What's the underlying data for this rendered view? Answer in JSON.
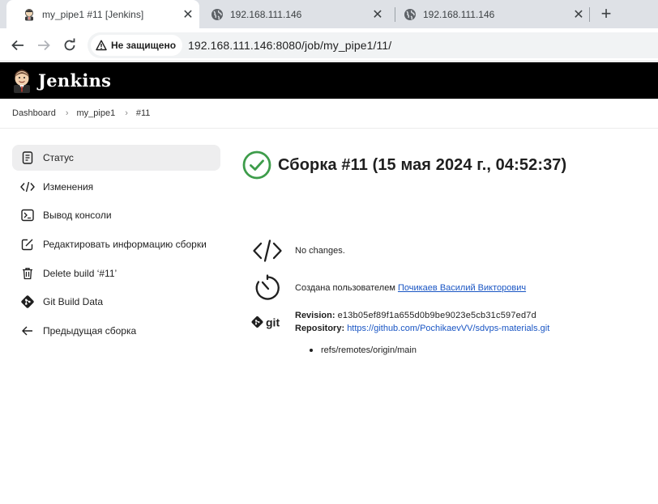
{
  "browser": {
    "tabs": [
      {
        "title": "my_pipe1 #11 [Jenkins]",
        "icon": "jenkins-favicon",
        "active": true
      },
      {
        "title": "192.168.111.146",
        "icon": "globe-icon",
        "active": false
      },
      {
        "title": "192.168.111.146",
        "icon": "globe-icon",
        "active": false
      }
    ],
    "security_label": "Не защищено",
    "url": "192.168.111.146:8080/job/my_pipe1/11/"
  },
  "header": {
    "brand": "Jenkins"
  },
  "breadcrumb": [
    "Dashboard",
    "my_pipe1",
    "#11"
  ],
  "sidebar": {
    "items": [
      {
        "label": "Статус",
        "icon": "document-icon",
        "active": true
      },
      {
        "label": "Изменения",
        "icon": "code-icon"
      },
      {
        "label": "Вывод консоли",
        "icon": "terminal-icon"
      },
      {
        "label": "Редактировать информацию сборки",
        "icon": "edit-icon"
      },
      {
        "label": "Delete build ‘#11’",
        "icon": "trash-icon"
      },
      {
        "label": "Git Build Data",
        "icon": "git-icon"
      },
      {
        "label": "Предыдущая сборка",
        "icon": "arrow-left-icon"
      }
    ]
  },
  "build": {
    "title": "Сборка #11 (15 мая 2024 г., 04:52:37)",
    "status": "success",
    "changes_text": "No changes.",
    "started_by_prefix": "Создана пользователем",
    "started_by_user": "Почикаев Василий Викторович",
    "git": {
      "logo_text": "git",
      "revision_label": "Revision:",
      "revision": "e13b05ef89f1a655d0b9be9023e5cb31c597ed7d",
      "repository_label": "Repository:",
      "repository_url": "https://github.com/PochikaevVV/sdvps-materials.git",
      "branches": [
        "refs/remotes/origin/main"
      ]
    }
  },
  "colors": {
    "header_bg": "#000000",
    "success": "#3d9c4a",
    "link": "#1a56c4",
    "active_item": "#eeeeef"
  }
}
